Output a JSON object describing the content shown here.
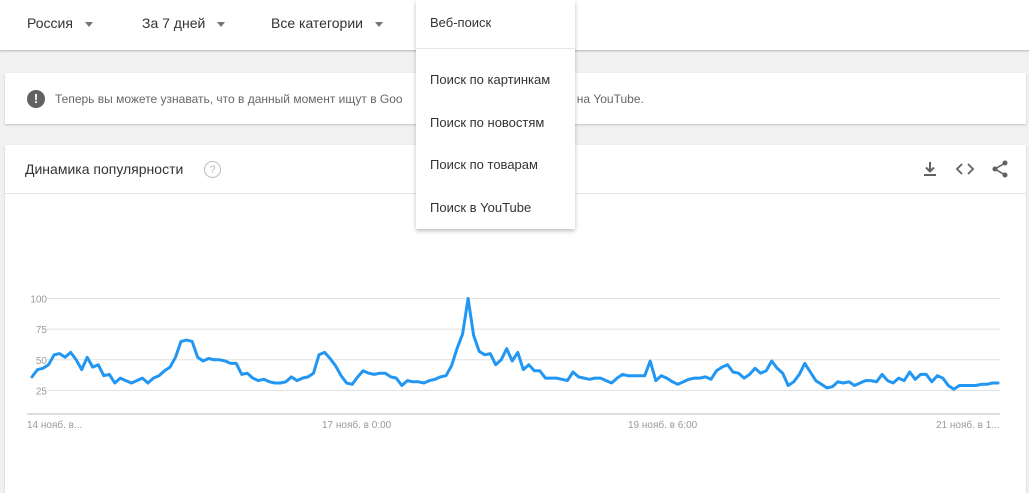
{
  "filters": {
    "region": "Россия",
    "period": "За 7 дней",
    "category": "Все категории"
  },
  "search_type_menu": {
    "selected": "Веб-поиск",
    "options": [
      "Поиск по картинкам",
      "Поиск по новостям",
      "Поиск по товарам",
      "Поиск в YouTube"
    ]
  },
  "notice": {
    "icon": "info-icon",
    "text_before": "Теперь вы можете узнавать, что в данный момент ищут в Goo",
    "text_after": "окупках и на YouTube."
  },
  "card": {
    "title": "Динамика популярности",
    "help_icon": "question-icon",
    "actions": [
      "download-icon",
      "embed-icon",
      "share-icon"
    ]
  },
  "colors": {
    "line": "#2196f3",
    "grid": "#e0e0e0",
    "tick": "#999999"
  },
  "chart_data": {
    "type": "line",
    "ylim": [
      0,
      100
    ],
    "yticks": [
      25,
      50,
      75,
      100
    ],
    "xtick_labels": [
      "14 нояб. в...",
      "17 нояб. в 0:00",
      "19 нояб. в 6:00",
      "21 нояб. в 1..."
    ],
    "grid": true,
    "series": [
      {
        "values": [
          36,
          42,
          43,
          46,
          54,
          55,
          52,
          56,
          50,
          42,
          52,
          44,
          46,
          37,
          38,
          31,
          35,
          33,
          31,
          33,
          35,
          31,
          35,
          37,
          41,
          44,
          52,
          65,
          66,
          65,
          52,
          49,
          51,
          50,
          50,
          49,
          47,
          47,
          38,
          39,
          35,
          33,
          34,
          32,
          31,
          31,
          32,
          36,
          33,
          35,
          36,
          39,
          54,
          56,
          51,
          45,
          37,
          31,
          30,
          36,
          41,
          39,
          38,
          39,
          39,
          36,
          35,
          29,
          33,
          32,
          32,
          31,
          33,
          34,
          36,
          37,
          45,
          59,
          71,
          100,
          70,
          57,
          54,
          55,
          46,
          50,
          59,
          49,
          56,
          42,
          46,
          41,
          41,
          35,
          35,
          35,
          34,
          33,
          40,
          36,
          35,
          34,
          35,
          35,
          33,
          31,
          35,
          38,
          37,
          37,
          37,
          37,
          49,
          33,
          37,
          35,
          32,
          30,
          32,
          34,
          35,
          35,
          36,
          34,
          41,
          44,
          46,
          40,
          39,
          35,
          38,
          43,
          39,
          41,
          49,
          43,
          39,
          29,
          32,
          38,
          47,
          40,
          33,
          30,
          27,
          28,
          32,
          31,
          32,
          29,
          31,
          33,
          33,
          32,
          38,
          33,
          31,
          35,
          33,
          40,
          34,
          38,
          38,
          32,
          37,
          35,
          29,
          26,
          29,
          29,
          29,
          29,
          30,
          30,
          31,
          31
        ]
      }
    ]
  }
}
